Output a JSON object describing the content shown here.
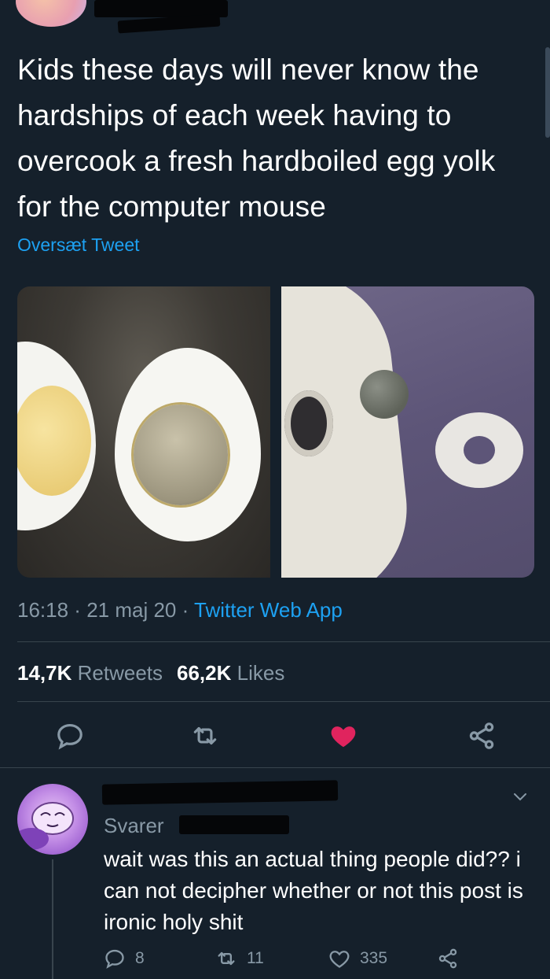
{
  "tweet": {
    "text": "Kids these days will never know the hardships of each week having to overcook a fresh hardboiled egg yolk for the computer mouse",
    "translate_label": "Oversæt Tweet",
    "time": "16:18",
    "date": "21 maj 20",
    "separator": " · ",
    "source": "Twitter Web App",
    "retweet_count": "14,7K",
    "retweet_label": "Retweets",
    "like_count": "66,2K",
    "like_label": "Likes"
  },
  "reply": {
    "replying_label": "Svarer",
    "text": "wait was this an actual thing people did?? i can not decipher whether or not this post is ironic holy shit",
    "reply_count": "8",
    "retweet_count": "11",
    "like_count": "335"
  },
  "colors": {
    "background": "#15202b",
    "accent": "#1da1f2",
    "like": "#e0245e",
    "muted": "#8899a6",
    "divider": "#38444d"
  },
  "icons": [
    "reply-icon",
    "retweet-icon",
    "like-icon",
    "share-icon",
    "chevron-down-icon"
  ]
}
